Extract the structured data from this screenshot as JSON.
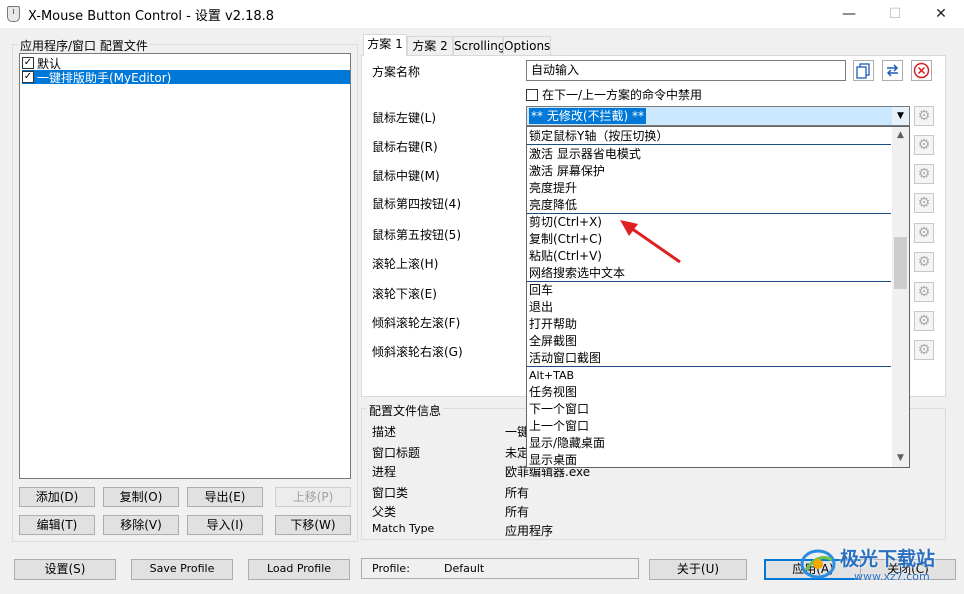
{
  "window": {
    "title": "X-Mouse Button Control - 设置 v2.18.8",
    "minimize": "—",
    "maximize": "☐",
    "close": "✕"
  },
  "profiles": {
    "group_title": "应用程序/窗口 配置文件",
    "items": [
      {
        "label": "默认",
        "checked": true,
        "selected": false
      },
      {
        "label": "一键排版助手(MyEditor)",
        "checked": true,
        "selected": true
      }
    ],
    "check_glyph": "✓"
  },
  "profile_buttons": {
    "add": "添加(D)",
    "copy": "复制(O)",
    "export": "导出(E)",
    "move_up": "上移(P)",
    "edit": "编辑(T)",
    "remove": "移除(V)",
    "import": "导入(I)",
    "move_down": "下移(W)"
  },
  "tabs": [
    "方案 1",
    "方案 2",
    "Scrolling",
    "Options"
  ],
  "scheme": {
    "name_label": "方案名称",
    "name_value": "自动输入",
    "disable_checkbox_label": "在下一/上一方案的命令中禁用",
    "disable_checked": false
  },
  "button_labels": [
    "鼠标左键(L)",
    "鼠标右键(R)",
    "鼠标中键(M)",
    "鼠标第四按钮(4)",
    "鼠标第五按钮(5)",
    "滚轮上滚(H)",
    "滚轮下滚(E)",
    "倾斜滚轮左滚(F)",
    "倾斜滚轮右滚(G)"
  ],
  "left_button_combo": {
    "value": "** 无修改(不拦截) **"
  },
  "dropdown_items": [
    {
      "label": "锁定鼠标Y轴（按压切换）",
      "sep": true
    },
    {
      "label": "激活 显示器省电模式"
    },
    {
      "label": "激活 屏幕保护"
    },
    {
      "label": "亮度提升"
    },
    {
      "label": "亮度降低",
      "sep": true
    },
    {
      "label": "剪切(Ctrl+X)"
    },
    {
      "label": "复制(Ctrl+C)"
    },
    {
      "label": "粘贴(Ctrl+V)"
    },
    {
      "label": "网络搜索选中文本",
      "sep": true
    },
    {
      "label": "回车"
    },
    {
      "label": "退出"
    },
    {
      "label": "打开帮助"
    },
    {
      "label": "全屏截图"
    },
    {
      "label": "活动窗口截图",
      "sep": true
    },
    {
      "label": "Alt+TAB",
      "small": true
    },
    {
      "label": "任务视图"
    },
    {
      "label": "下一个窗口"
    },
    {
      "label": "上一个窗口"
    },
    {
      "label": "显示/隐藏桌面"
    },
    {
      "label": "显示桌面"
    }
  ],
  "profile_info": {
    "title": "配置文件信息",
    "rows": [
      {
        "label": "描述",
        "value": "一键"
      },
      {
        "label": "窗口标题",
        "value": "未定"
      },
      {
        "label": "进程",
        "value": "欧菲编辑器.exe"
      },
      {
        "label": "窗口类",
        "value": "所有"
      },
      {
        "label": "父类",
        "value": "所有"
      },
      {
        "label": "Match Type",
        "value": "应用程序"
      }
    ]
  },
  "bottom": {
    "settings": "设置(S)",
    "save_profile": "Save Profile",
    "load_profile": "Load Profile",
    "profile_label": "Profile:",
    "profile_value": "Default",
    "about": "关于(U)",
    "apply": "应用(A)",
    "close": "关闭(C)"
  },
  "watermark": {
    "brand": "极光下载站",
    "url": "www.xz7.com"
  },
  "colors": {
    "selection": "#0078d7",
    "annotation_arrow": "#e02020",
    "dropdown_separator": "#1a4e85"
  }
}
